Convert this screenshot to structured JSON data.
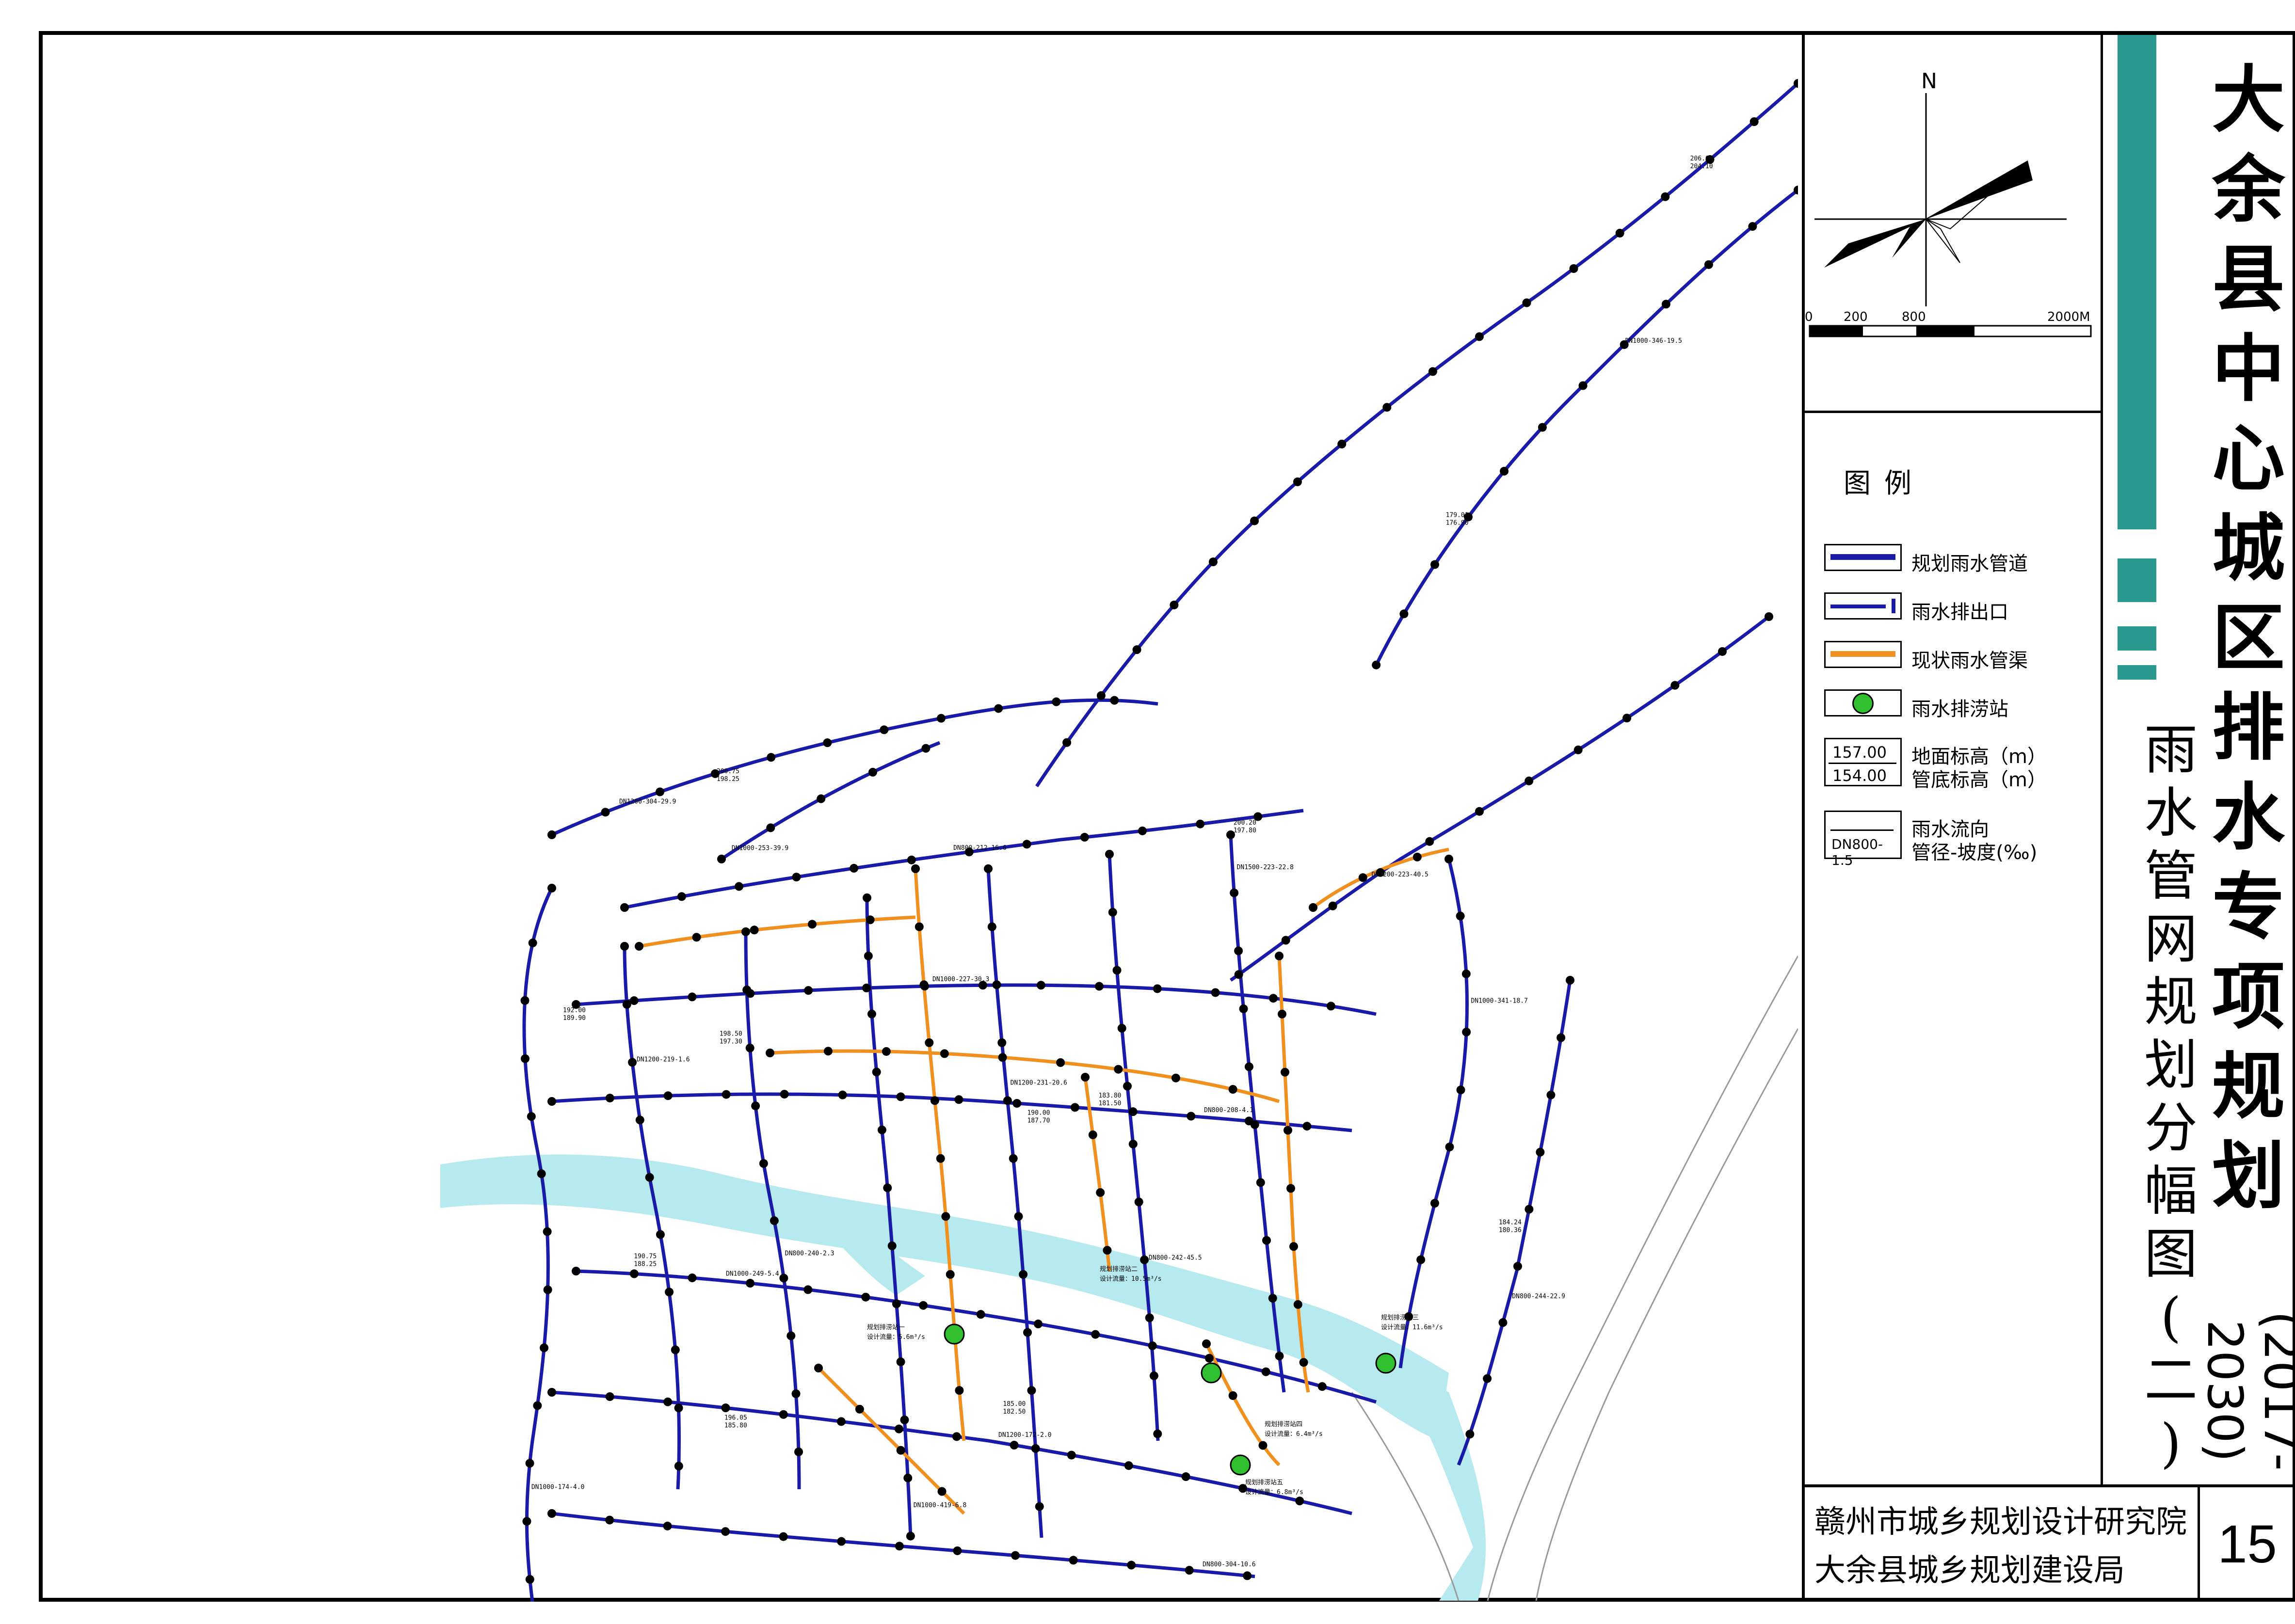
{
  "title": {
    "main": "大余县中心城区排水专项规划",
    "period": "(2017-2030)",
    "subtitle": "雨水管网规划分幅图(二)"
  },
  "legend": {
    "heading": "图例",
    "items": [
      {
        "id": "planned-pipe",
        "label": "规划雨水管道",
        "color": "#1a1aa8"
      },
      {
        "id": "outlet",
        "label": "雨水排出口",
        "color": "#1a1aa8"
      },
      {
        "id": "existing-pipe",
        "label": "现状雨水管渠",
        "color": "#f0901e"
      },
      {
        "id": "pump-station",
        "label": "雨水排涝站",
        "color": "#2fbf2f"
      }
    ],
    "elevation_sample": {
      "ground": "157.00",
      "invert": "154.00",
      "ground_label": "地面标高（m）",
      "invert_label": "管底标高（m）"
    },
    "flow_sample": {
      "code": "DN800-1.5",
      "flow_label": "雨水流向",
      "spec_label": "管径-坡度(‰)"
    }
  },
  "compass": {
    "north": "N"
  },
  "scale_bar": {
    "labels": [
      "0",
      "200",
      "800",
      "2000M"
    ]
  },
  "org": {
    "line1": "赣州市城乡规划设计研究院",
    "line2": "大余县城乡规划建设局",
    "sheet_no": "15",
    "footer_seal": "赣州市城乡规划设计研究院"
  },
  "map_labels": {
    "pump_1": "规划排涝站一",
    "pump_1_cap": "设计流量：5.6m³/s",
    "pump_2": "规划排涝站二",
    "pump_2_cap": "设计流量：10.5m³/s",
    "pump_3": "规划排涝站三",
    "pump_3_cap": "设计流量：11.6m³/s",
    "pump_4": "规划排涝站四",
    "pump_4_cap": "设计流量：6.4m³/s",
    "pump_5": "规划排涝站五",
    "pump_5_cap": "设计流量：6.8m³/s",
    "pipes": [
      "DN1000-424-11.5",
      "DN1000-346-19.5",
      "DN1200-223-40.5",
      "DN1200-304-29.9",
      "DN800-212-16.6",
      "DN1000-174-4.0",
      "DN1200-219-1.6",
      "DN800-240-2.3",
      "DN1000-419-6.8",
      "DN1200-231-20.6",
      "DN800-242-45.5",
      "DN1500-223-22.8",
      "DN1000-227-30.3",
      "DN800-208-4.1",
      "DN1000-249-5.4",
      "DN1200-172-2.0",
      "DN800-304-10.6",
      "DN1000-341-18.7",
      "DN800-244-22.9",
      "DN1000-253-39.9"
    ],
    "elevations": [
      [
        "206.60",
        "204.10"
      ],
      [
        "200.75",
        "198.25"
      ],
      [
        "190.75",
        "188.25"
      ],
      [
        "185.00",
        "182.50"
      ],
      [
        "192.00",
        "189.90"
      ],
      [
        "196.05",
        "185.80"
      ],
      [
        "184.24",
        "180.36"
      ],
      [
        "179.01",
        "176.90"
      ],
      [
        "200.20",
        "197.80"
      ],
      [
        "198.50",
        "197.30"
      ],
      [
        "183.80",
        "181.50"
      ],
      [
        "190.00",
        "187.70"
      ]
    ]
  }
}
